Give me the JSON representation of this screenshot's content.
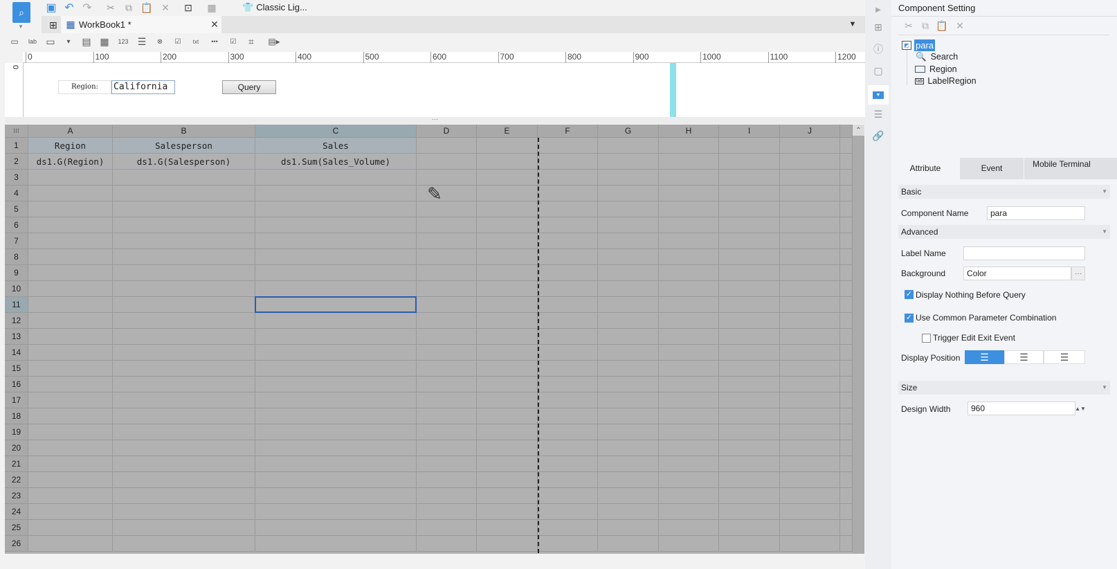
{
  "toolbar": {
    "theme_label": "Classic Lig..."
  },
  "tab": {
    "label": "WorkBook1 *"
  },
  "ruler": {
    "ticks": [
      "0",
      "100",
      "200",
      "300",
      "400",
      "500",
      "600",
      "700",
      "800",
      "900",
      "1000",
      "1100",
      "1200"
    ],
    "vertical_zero": "0"
  },
  "param_pane": {
    "label": "Region:",
    "input_value": "California",
    "query_button": "Query"
  },
  "grid": {
    "columns": [
      "A",
      "B",
      "C",
      "D",
      "E",
      "F",
      "G",
      "H",
      "I",
      "J"
    ],
    "rows": [
      "1",
      "2",
      "3",
      "4",
      "5",
      "6",
      "7",
      "8",
      "9",
      "10",
      "11",
      "12",
      "13",
      "14",
      "15",
      "16",
      "17",
      "18",
      "19",
      "20",
      "21",
      "22",
      "23",
      "24",
      "25",
      "26"
    ],
    "row1": [
      "Region",
      "Salesperson",
      "Sales"
    ],
    "row2": [
      "ds1.G(Region)",
      "ds1.G(Salesperson)",
      "ds1.Sum(Sales_Volume)"
    ],
    "selected_cell": "C11"
  },
  "panel": {
    "title": "Component Setting",
    "tree": {
      "root": "para",
      "children": [
        "Search",
        "Region",
        "LabelRegion"
      ]
    },
    "tabs": [
      "Attribute",
      "Event",
      "Mobile Terminal"
    ],
    "basic": "Basic",
    "component_name_label": "Component Name",
    "component_name": "para",
    "advanced": "Advanced",
    "label_name_label": "Label Name",
    "label_name": "",
    "background_label": "Background",
    "background": "Color",
    "display_nothing": "Display Nothing Before Query",
    "common_param": "Use Common Parameter Combination",
    "trigger_edit": "Trigger Edit Exit Event",
    "display_position_label": "Display Position",
    "size": "Size",
    "design_width_label": "Design Width",
    "design_width": "960"
  },
  "colors": {
    "accent": "#3d8fe0",
    "grid_bg": "#b1b1b1",
    "selection": "#2a5db0"
  }
}
